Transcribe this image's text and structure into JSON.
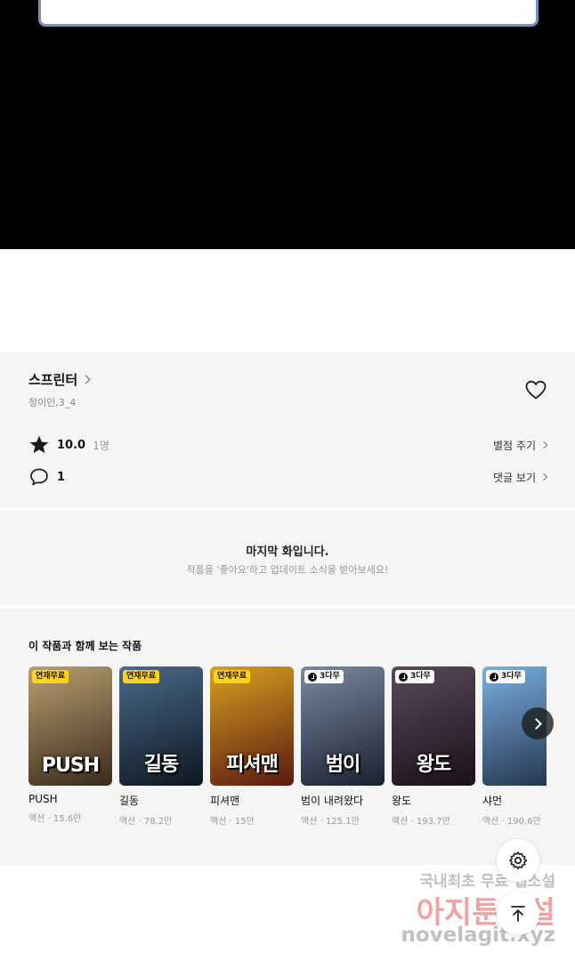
{
  "series": {
    "title": "스프린터",
    "author": "정이인,3_4"
  },
  "rating": {
    "score": "10.0",
    "count": "1명",
    "action": "별점 주기"
  },
  "comments": {
    "count": "1",
    "action": "댓글 보기"
  },
  "last_episode": {
    "title": "마지막 화입니다.",
    "subtitle": "작품을 '좋아요'하고 업데이트 소식을 받아보세요!"
  },
  "recommendations": {
    "title": "이 작품과 함께 보는 작품",
    "items": [
      {
        "name": "PUSH",
        "meta": "액션 · 15.6만",
        "badge": "연재무료",
        "badge_type": "free",
        "logo": "PUSH",
        "colors": [
          "#b8a070",
          "#3a2a1c"
        ]
      },
      {
        "name": "길동",
        "meta": "액션 · 78.2만",
        "badge": "연재무료",
        "badge_type": "free",
        "logo": "길동",
        "colors": [
          "#4a6a8a",
          "#0e1620"
        ]
      },
      {
        "name": "피셔맨",
        "meta": "액션 · 15만",
        "badge": "연재무료",
        "badge_type": "free",
        "logo": "피셔맨",
        "colors": [
          "#d8a020",
          "#5a1a10"
        ]
      },
      {
        "name": "범이 내려왔다",
        "meta": "액션 · 125.1만",
        "badge": "3다무",
        "badge_type": "wait",
        "logo": "범이",
        "colors": [
          "#7a8aa0",
          "#1a2030"
        ]
      },
      {
        "name": "왕도",
        "meta": "액션 · 193.7만",
        "badge": "3다무",
        "badge_type": "wait",
        "logo": "왕도",
        "colors": [
          "#5a4a5a",
          "#1a1018"
        ]
      },
      {
        "name": "샤먼",
        "meta": "액션 · 190.6만",
        "badge": "3다무",
        "badge_type": "wait",
        "logo": "",
        "colors": [
          "#7ab0e0",
          "#22304a"
        ]
      }
    ]
  },
  "watermark": {
    "line1": "국내최초 무료 웹소설",
    "line2": "아지툰소설",
    "line3": "novelagit.xyz"
  },
  "icons": {
    "heart": "heart-outline-icon",
    "star": "star-icon",
    "comment": "speech-bubble-icon",
    "next": "chevron-right-icon",
    "settings": "gear-icon",
    "top": "arrow-up-icon"
  }
}
